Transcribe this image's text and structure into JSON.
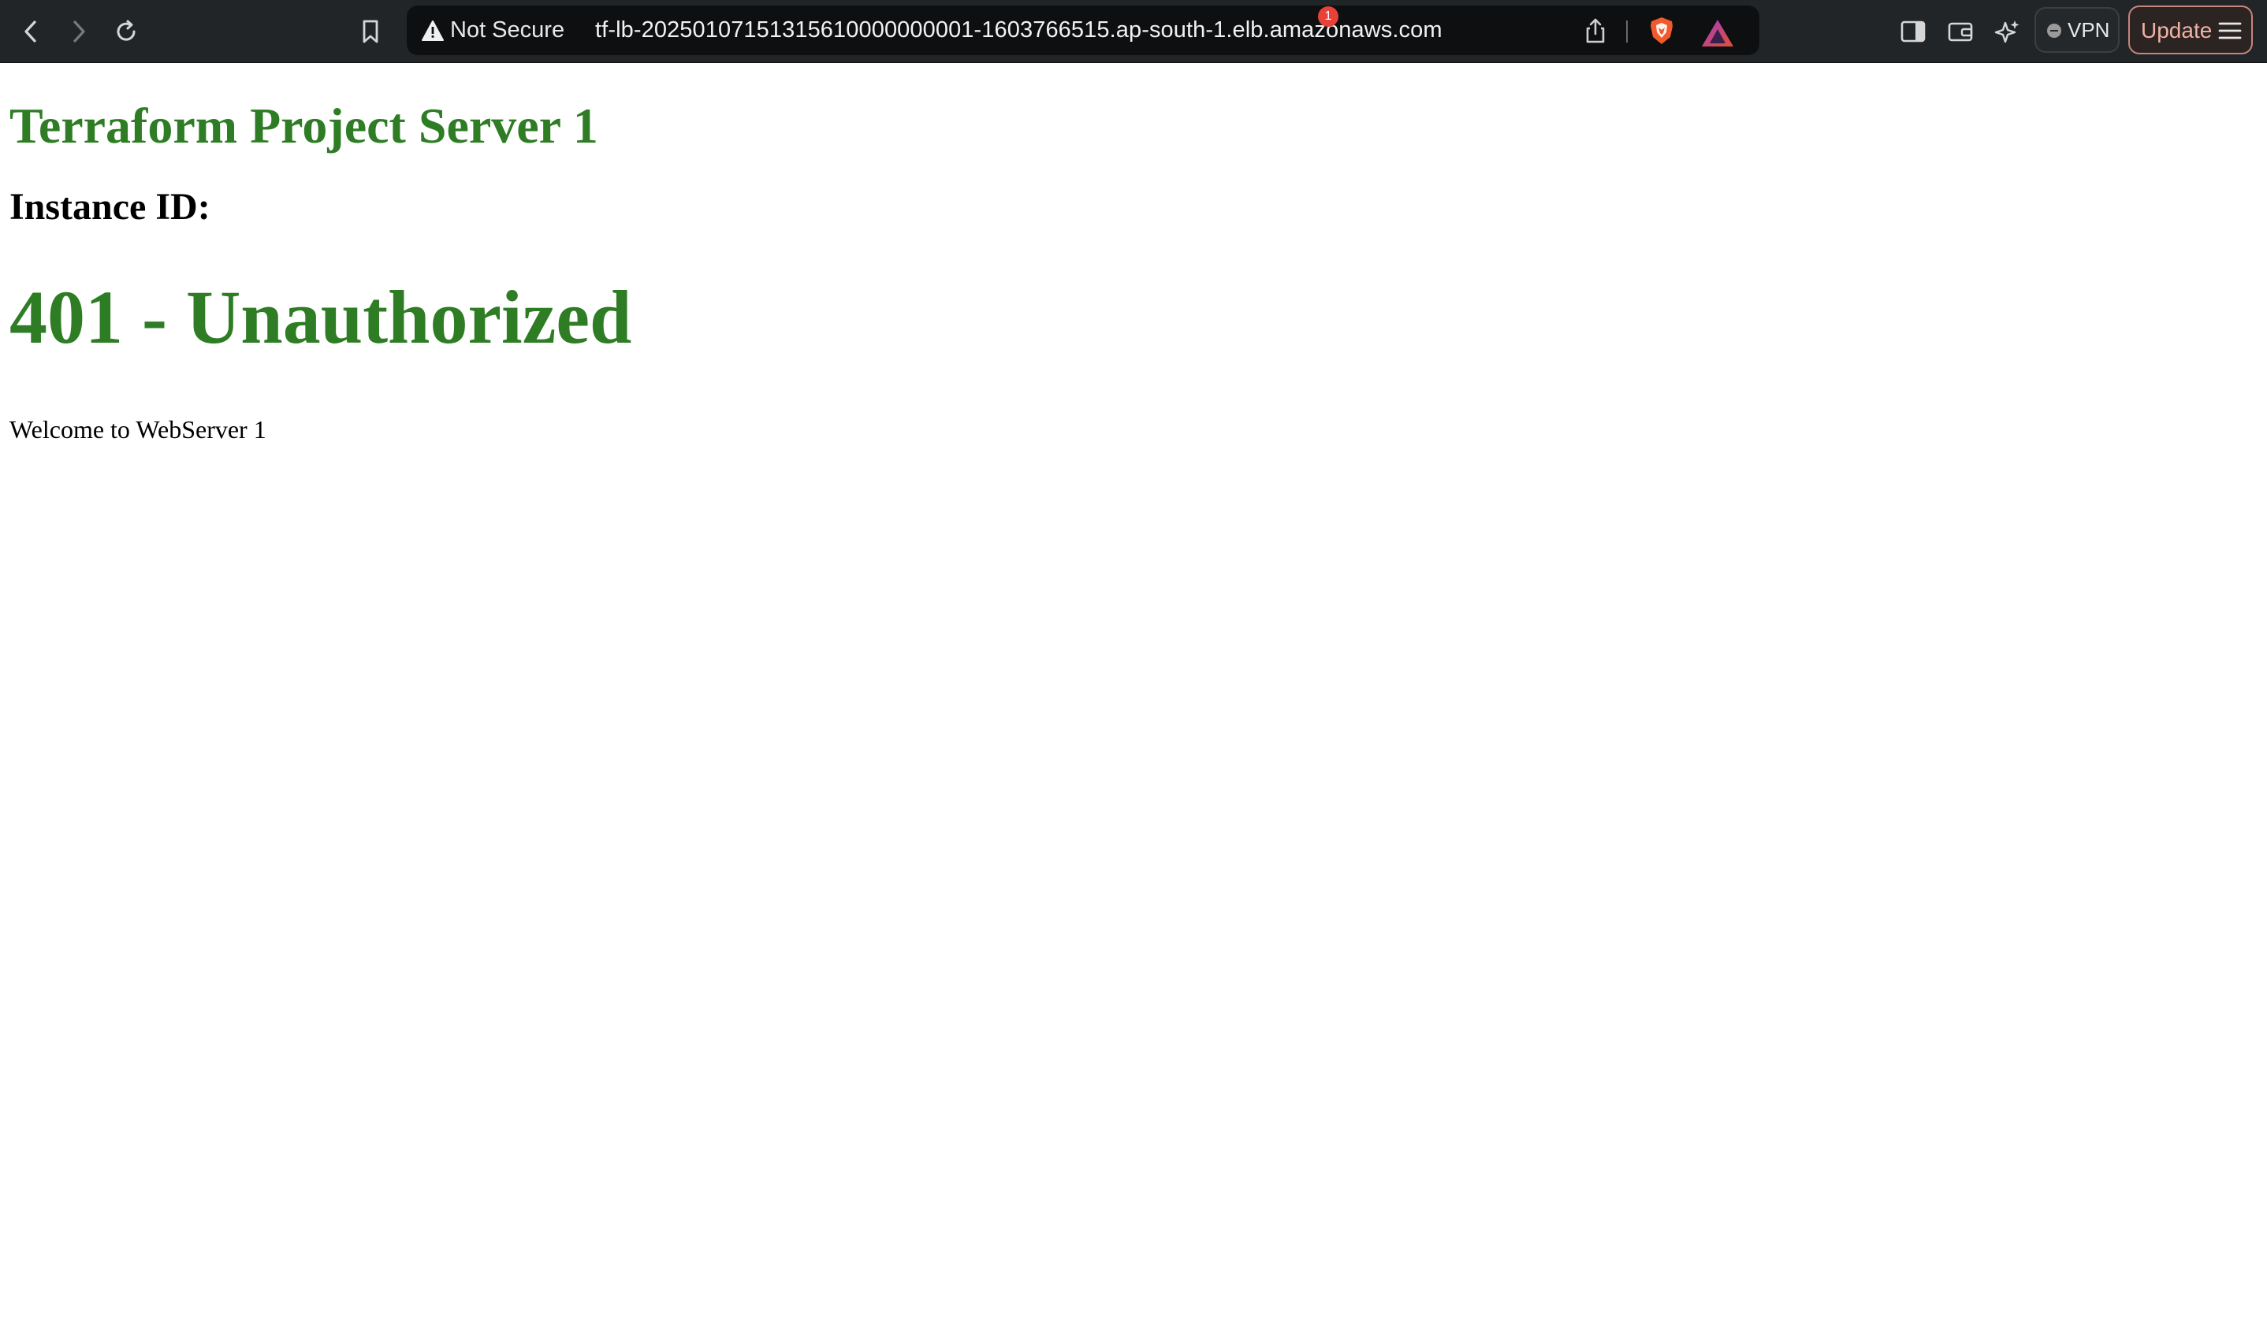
{
  "browser": {
    "url_bar": {
      "security_label": "Not Secure",
      "url": "tf-lb-20250107151315610000000001-1603766515.ap-south-1.elb.amazonaws.com"
    },
    "rewards_badge_count": "1",
    "vpn_label": "VPN",
    "update_label": "Update",
    "icons": {
      "back": "back-arrow-icon",
      "forward": "forward-arrow-icon",
      "reload": "reload-icon",
      "bookmark": "bookmark-icon",
      "warning": "warning-triangle-icon",
      "share": "share-icon",
      "shields": "brave-shields-icon",
      "rewards": "brave-rewards-icon",
      "sidebar": "sidebar-icon",
      "wallet": "wallet-icon",
      "leo": "leo-ai-icon",
      "menu": "hamburger-menu-icon"
    },
    "colors": {
      "toolbar": "#222528",
      "url_bar": "#0e0f10",
      "update_border": "#c8857a",
      "badge": "#e8413a"
    }
  },
  "page": {
    "title": "Terraform Project Server 1",
    "instance_label": "Instance ID:",
    "error_heading": "401 - Unauthorized",
    "welcome_text": "Welcome to WebServer 1",
    "colors": {
      "heading_green": "#2e7d24",
      "text": "#000000",
      "background": "#ffffff"
    }
  }
}
